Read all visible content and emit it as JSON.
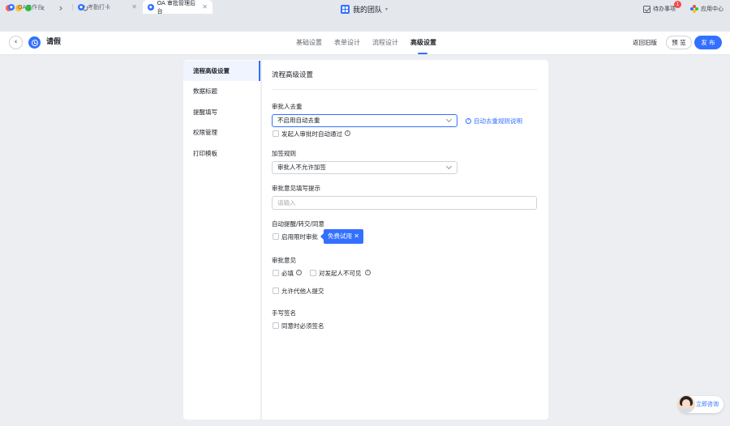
{
  "window": {
    "team_name": "我的团队",
    "todo_label": "待办事项",
    "todo_badge": "1",
    "app_center_label": "应用中心"
  },
  "tabs": [
    {
      "label": "OA工作台",
      "color": "#3370ff"
    },
    {
      "label": "考勤打卡",
      "color": "#3370ff"
    },
    {
      "label": "OA 审批管理后台",
      "color": "#3370ff"
    }
  ],
  "toolbar": {
    "form_name": "请假",
    "steps": [
      "基础设置",
      "表单设计",
      "流程设计",
      "高级设置"
    ],
    "active_step": "高级设置",
    "old_version_label": "返回旧版",
    "preview_label": "预 览",
    "publish_label": "发 布"
  },
  "menu": {
    "items": [
      "流程高级设置",
      "数据标题",
      "提醒填写",
      "权限管理",
      "打印模板"
    ],
    "active": "流程高级设置"
  },
  "main": {
    "title": "流程高级设置",
    "dedupe": {
      "label": "审批人去重",
      "selected": "不启用自动去重",
      "rule_link": "自动去重规则说明",
      "auto_pass_label": "发起人审批时自动通过"
    },
    "countersign": {
      "label": "加签规则",
      "selected": "审批人不允许加签"
    },
    "opinion_hint": {
      "label": "审批意见填写提示",
      "placeholder": "请输入"
    },
    "auto_remind": {
      "label": "自动提醒/转交/同意",
      "limit_label": "启用限时审批",
      "trial_label": "免费试用"
    },
    "opinion": {
      "label": "审批意见",
      "required_label": "必填",
      "invisible_label": "对发起人不可见",
      "proxy_label": "允许代他人提交"
    },
    "signature": {
      "label": "手写签名",
      "sign_on_agree_label": "同意时必须签名"
    }
  },
  "consult": {
    "label": "立即咨询"
  },
  "colors": {
    "accent": "#3370ff",
    "danger": "#f54a45"
  }
}
